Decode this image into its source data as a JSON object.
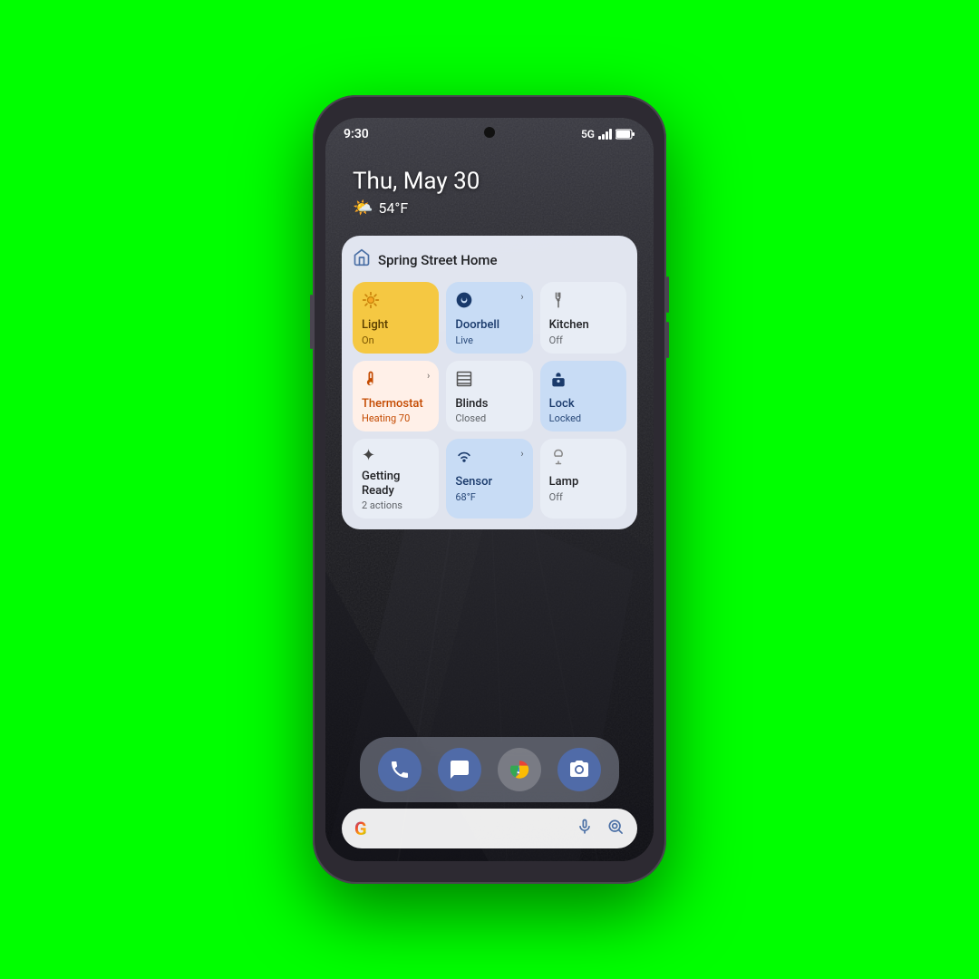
{
  "status_bar": {
    "time": "9:30",
    "signal": "5G"
  },
  "date": {
    "text": "Thu, May 30",
    "weather_icon": "🌤️",
    "temperature": "54°F"
  },
  "widget": {
    "title": "Spring Street Home",
    "home_icon": "⌂",
    "tiles": [
      {
        "id": "light",
        "name": "Light",
        "status": "On",
        "icon": "💡",
        "color": "yellow",
        "has_arrow": false
      },
      {
        "id": "doorbell",
        "name": "Doorbell",
        "status": "Live",
        "icon": "📷",
        "color": "blue",
        "has_arrow": true
      },
      {
        "id": "kitchen",
        "name": "Kitchen",
        "status": "Off",
        "icon": "💡",
        "color": "white",
        "has_arrow": false
      },
      {
        "id": "thermostat",
        "name": "Thermostat",
        "status": "Heating 70",
        "icon": "🌡️",
        "color": "orange",
        "has_arrow": true
      },
      {
        "id": "blinds",
        "name": "Blinds",
        "status": "Closed",
        "icon": "▦",
        "color": "white",
        "has_arrow": false
      },
      {
        "id": "lock",
        "name": "Lock",
        "status": "Locked",
        "icon": "🔒",
        "color": "blue",
        "has_arrow": false
      },
      {
        "id": "getting-ready",
        "name": "Getting Ready",
        "status": "2 actions",
        "icon": "✦",
        "color": "white",
        "has_arrow": false
      },
      {
        "id": "sensor",
        "name": "Sensor",
        "status": "68°F",
        "icon": "📶",
        "color": "blue",
        "has_arrow": true
      },
      {
        "id": "lamp",
        "name": "Lamp",
        "status": "Off",
        "icon": "💡",
        "color": "white",
        "has_arrow": false
      }
    ]
  },
  "dock": {
    "apps": [
      {
        "id": "phone",
        "icon": "📞"
      },
      {
        "id": "messages",
        "icon": "💬"
      },
      {
        "id": "chrome",
        "icon": "◎"
      },
      {
        "id": "camera",
        "icon": "📷"
      }
    ]
  },
  "search_bar": {
    "google_letter": "G",
    "mic_icon": "🎤",
    "lens_icon": "⊙"
  }
}
